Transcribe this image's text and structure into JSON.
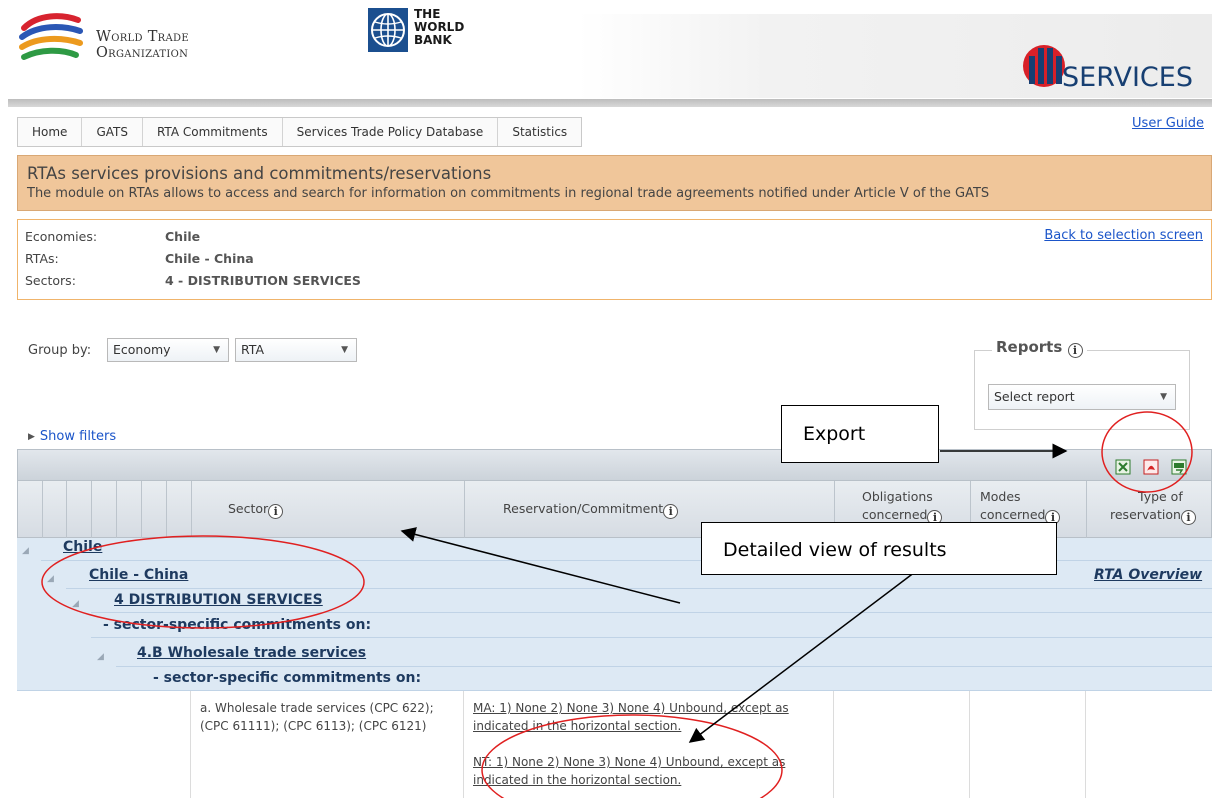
{
  "header": {
    "wto_line1": "World Trade",
    "wto_line2": "Organization",
    "wb_line1": "THE",
    "wb_line2": "WORLD",
    "wb_line3": "BANK",
    "itip_label": "SERVICES"
  },
  "nav": {
    "tabs": [
      "Home",
      "GATS",
      "RTA Commitments",
      "Services Trade Policy Database",
      "Statistics"
    ],
    "user_guide": "User Guide"
  },
  "banner": {
    "title": "RTAs services provisions and commitments/reservations",
    "subtitle": "The module on RTAs allows to access and search for information on commitments in regional trade agreements notified under Article V of the GATS"
  },
  "selection": {
    "economies_label": "Economies:",
    "economies_value": "Chile",
    "rtas_label": "RTAs:",
    "rtas_value": "Chile - China",
    "sectors_label": "Sectors:",
    "sectors_value": "4 - DISTRIBUTION SERVICES",
    "back_link": "Back to selection screen"
  },
  "groupby": {
    "label": "Group by:",
    "first": "Economy",
    "second": "RTA"
  },
  "reports": {
    "title": "Reports",
    "select_placeholder": "Select report"
  },
  "show_filters": "Show filters",
  "export_icons": [
    "excel-export-icon",
    "pdf-export-icon",
    "csv-export-icon"
  ],
  "grid": {
    "columns": {
      "sector": "Sector",
      "reservation": "Reservation/Commitment",
      "obligations_1": "Obligations",
      "obligations_2": "concerned",
      "modes_1": "Modes",
      "modes_2": "concerned",
      "type_1": "Type of",
      "type_2": "reservation"
    },
    "groups": {
      "economy": "Chile",
      "rta": "Chile - China",
      "rta_overview": "RTA Overview",
      "sector": "4 DISTRIBUTION SERVICES",
      "commitments_1": "- sector-specific commitments on:",
      "subsector": "4.B Wholesale trade services",
      "commitments_2": "- sector-specific commitments on:"
    },
    "row": {
      "sector_line1": "a. Wholesale trade services (CPC 622);",
      "sector_line2": "(CPC 61111); (CPC 6113); (CPC 6121)",
      "ma_line1": "MA: 1) None 2) None 3) None 4) Unbound, except as",
      "ma_line2": "indicated in the horizontal section.",
      "nt_line1": "NT: 1) None 2) None 3) None 4) Unbound, except as",
      "nt_line2": "indicated in the horizontal section."
    }
  },
  "annotations": {
    "export": "Export",
    "detailed_view": "Detailed view of results"
  },
  "colors": {
    "banner": "#f0c69a",
    "link": "#1b55c9",
    "group_row": "#dde9f4",
    "annotation_ellipse": "#e02020"
  }
}
